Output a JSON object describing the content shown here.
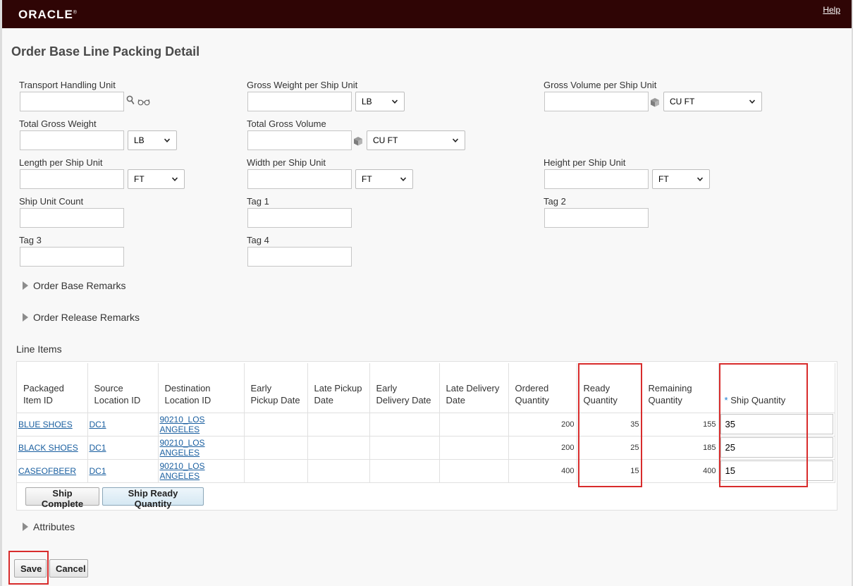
{
  "header": {
    "logo": "ORACLE",
    "logo_mark": "®",
    "help": "Help"
  },
  "page": {
    "title": "Order Base Line Packing Detail"
  },
  "form": {
    "transport_handling_unit": {
      "label": "Transport Handling Unit",
      "value": ""
    },
    "gross_weight_per_ship_unit": {
      "label": "Gross Weight per Ship Unit",
      "value": "",
      "unit": "LB"
    },
    "gross_volume_per_ship_unit": {
      "label": "Gross Volume per Ship Unit",
      "value": "",
      "unit": "CU FT"
    },
    "total_gross_weight": {
      "label": "Total Gross Weight",
      "value": "",
      "unit": "LB"
    },
    "total_gross_volume": {
      "label": "Total Gross Volume",
      "value": "",
      "unit": "CU FT"
    },
    "length_per_ship_unit": {
      "label": "Length per Ship Unit",
      "value": "",
      "unit": "FT"
    },
    "width_per_ship_unit": {
      "label": "Width per Ship Unit",
      "value": "",
      "unit": "FT"
    },
    "height_per_ship_unit": {
      "label": "Height per Ship Unit",
      "value": "",
      "unit": "FT"
    },
    "ship_unit_count": {
      "label": "Ship Unit Count",
      "value": ""
    },
    "tag1": {
      "label": "Tag 1",
      "value": ""
    },
    "tag2": {
      "label": "Tag 2",
      "value": ""
    },
    "tag3": {
      "label": "Tag 3",
      "value": ""
    },
    "tag4": {
      "label": "Tag 4",
      "value": ""
    }
  },
  "sections": {
    "order_base_remarks": "Order Base Remarks",
    "order_release_remarks": "Order Release Remarks",
    "line_items": "Line Items",
    "attributes": "Attributes"
  },
  "table": {
    "headers": {
      "packaged_item_id": "Packaged Item ID",
      "source_location_id": "Source Location ID",
      "destination_location_id": "Destination Location ID",
      "early_pickup_date": "Early Pickup Date",
      "late_pickup_date": "Late Pickup Date",
      "early_delivery_date": "Early Delivery Date",
      "late_delivery_date": "Late Delivery Date",
      "ordered_quantity": "Ordered Quantity",
      "ready_quantity": "Ready Quantity",
      "remaining_quantity": "Remaining Quantity",
      "ship_quantity_required": "*",
      "ship_quantity": "Ship Quantity"
    },
    "rows": [
      {
        "item": "BLUE SHOES",
        "source": "DC1",
        "destination": "90210_LOS ANGELES",
        "ordered": "200",
        "ready": "35",
        "remaining": "155",
        "ship": "35"
      },
      {
        "item": "BLACK SHOES",
        "source": "DC1",
        "destination": "90210_LOS ANGELES",
        "ordered": "200",
        "ready": "25",
        "remaining": "185",
        "ship": "25"
      },
      {
        "item": "CASEOFBEER",
        "source": "DC1",
        "destination": "90210_LOS ANGELES",
        "ordered": "400",
        "ready": "15",
        "remaining": "400",
        "ship": "15"
      }
    ]
  },
  "buttons": {
    "ship_complete": "Ship Complete",
    "ship_ready_quantity": "Ship Ready Quantity",
    "save": "Save",
    "cancel": "Cancel"
  },
  "colors": {
    "header_bg": "#2f0505",
    "highlight": "#d82c2c",
    "link": "#1a5fa0"
  }
}
